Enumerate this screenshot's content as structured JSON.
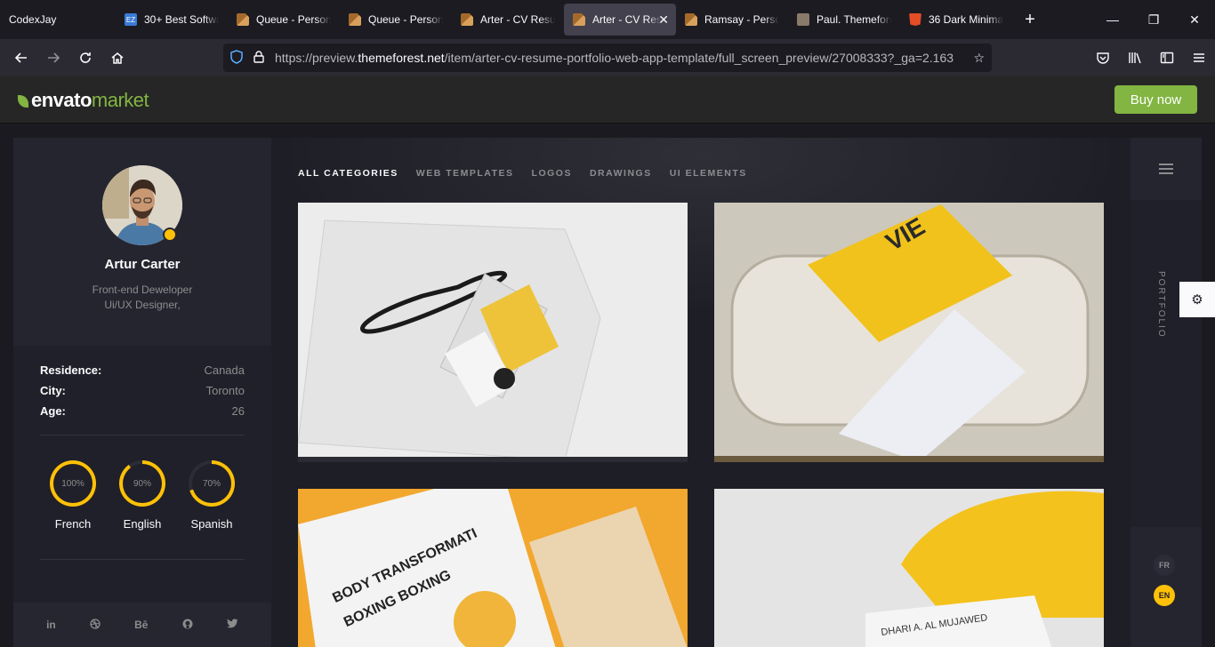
{
  "browser": {
    "profile": "CodexJay",
    "tabs": [
      {
        "title": "30+ Best Softwa",
        "icon": "ez-icon",
        "active": false
      },
      {
        "title": "Queue - Person",
        "icon": "doc-icon",
        "active": false
      },
      {
        "title": "Queue - Person",
        "icon": "doc-icon",
        "active": false
      },
      {
        "title": "Arter - CV Resur",
        "icon": "doc-icon",
        "active": false
      },
      {
        "title": "Arter - CV Res",
        "icon": "doc-icon",
        "active": true
      },
      {
        "title": "Ramsay - Persor",
        "icon": "doc-icon",
        "active": false
      },
      {
        "title": "Paul. Themefore",
        "icon": "person-icon",
        "active": false
      },
      {
        "title": "36 Dark Minimal",
        "icon": "html5-icon",
        "active": false
      }
    ],
    "url_prefix": "https://preview.",
    "url_domain": "themeforest.net",
    "url_path": "/item/arter-cv-resume-portfolio-web-app-template/full_screen_preview/27008333?_ga=2.163"
  },
  "envato": {
    "logo_main": "envato",
    "logo_accent": "market",
    "buy_label": "Buy now",
    "accent_color": "#82b541"
  },
  "profile": {
    "name": "Artur Carter",
    "role_line1": "Front-end Deweloper",
    "role_line2": "Ui/UX Designer,",
    "info": [
      {
        "key": "Residence:",
        "value": "Canada"
      },
      {
        "key": "City:",
        "value": "Toronto"
      },
      {
        "key": "Age:",
        "value": "26"
      }
    ],
    "languages": [
      {
        "name": "French",
        "percent_label": "100%",
        "level": 100
      },
      {
        "name": "English",
        "percent_label": "90%",
        "level": 90
      },
      {
        "name": "Spanish",
        "percent_label": "70%",
        "level": 70
      }
    ],
    "accent_color": "#ffc107",
    "social": [
      "in",
      "dribbble-icon",
      "Bē",
      "github-icon",
      "twitter-icon"
    ]
  },
  "portfolio": {
    "categories": [
      "ALL CATEGORIES",
      "WEB TEMPLATES",
      "LOGOS",
      "DRAWINGS",
      "UI ELEMENTS"
    ],
    "active_category": 0,
    "vertical_label": "PORTFOLIO"
  },
  "lang_switch": {
    "options": [
      "FR",
      "EN"
    ],
    "active": "EN"
  }
}
